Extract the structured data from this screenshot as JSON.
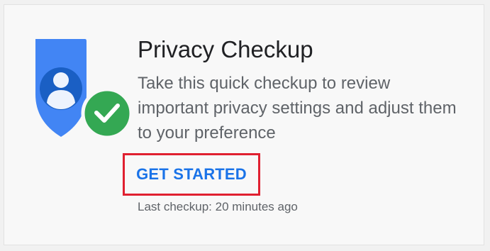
{
  "card": {
    "title": "Privacy Checkup",
    "description": "Take this quick checkup to review important privacy settings and adjust them to your preference",
    "action_label": "GET STARTED",
    "last_checkup": "Last checkup: 20 minutes ago"
  },
  "icons": {
    "shield": "shield-user-icon",
    "check": "check-badge-icon"
  },
  "colors": {
    "shield_blue": "#4285f4",
    "shield_dark": "#1a5fc4",
    "check_green": "#34a853",
    "action_blue": "#1a73e8",
    "highlight_red": "#e02030"
  }
}
